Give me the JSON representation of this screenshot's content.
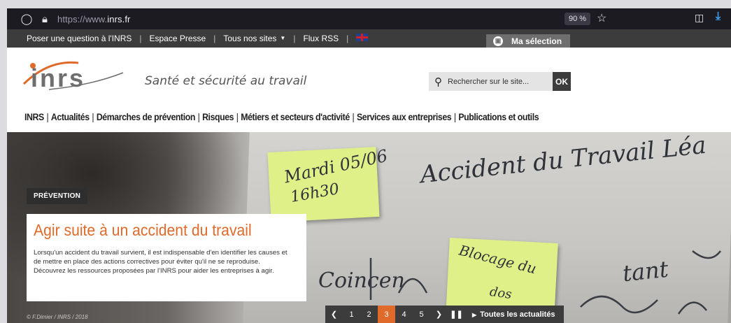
{
  "browser": {
    "url_prefix": "https://www.",
    "url_domain": "inrs.fr",
    "zoom": "90 %"
  },
  "topbar": {
    "links": [
      "Poser une question à l'INRS",
      "Espace Presse",
      "Tous nos sites",
      "Flux RSS"
    ],
    "selection_label": "Ma sélection"
  },
  "header": {
    "logo_text": "inrs",
    "tagline": "Santé et sécurité au travail",
    "search_placeholder": "Rechercher sur le site...",
    "search_button": "OK"
  },
  "nav": {
    "items": [
      "INRS",
      "Actualités",
      "Démarches de prévention",
      "Risques",
      "Métiers et secteurs d'activité",
      "Services aux entreprises",
      "Publications et outils"
    ]
  },
  "hero": {
    "category": "PRÉVENTION",
    "title": "Agir suite à un accident du travail",
    "text": "Lorsqu'un accident du travail survient, il est indispensable d'en identifier les causes et de mettre en place des actions correctives pour éviter qu'il ne se reproduise. Découvrez les ressources proposées par l'INRS pour aider les entreprises à agir.",
    "credit": "© F.Dimier / INRS / 2018",
    "note1_line1": "Mardi 05/06",
    "note1_line2": "16h30",
    "note2_line1": "Blocage du",
    "note2_line2": "dos",
    "board_line1": "Accident du Travail Léa",
    "board_line2": "Coincen",
    "board_line3": "tant"
  },
  "pager": {
    "pages": [
      "1",
      "2",
      "3",
      "4",
      "5"
    ],
    "active": "3",
    "all_label": "Toutes les actualités"
  },
  "colors": {
    "accent": "#e06a2a",
    "dark_bar": "#3c3c3c",
    "note": "#dff089"
  }
}
